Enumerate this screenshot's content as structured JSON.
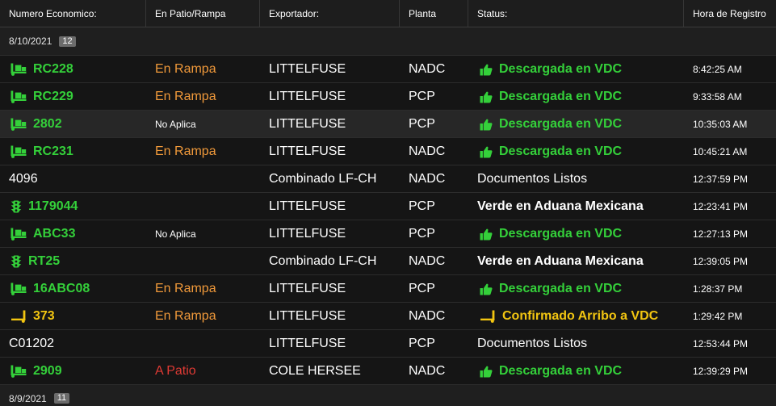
{
  "columns": {
    "numero": "Numero Economico:",
    "patio": "En Patio/Rampa",
    "exportador": "Exportador:",
    "planta": "Planta",
    "status": "Status:",
    "hora": "Hora de Registro"
  },
  "colors": {
    "background": "#151515",
    "green": "#34d03a",
    "orange": "#f0993a",
    "yellow": "#f2c511",
    "red": "#e03a34",
    "white": "#ffffff",
    "badge": "#6b6b6b"
  },
  "groups": [
    {
      "date": "8/10/2021",
      "count": "12",
      "rows": [
        {
          "numero": "RC228",
          "numero_icon": "dolly-icon",
          "numero_color": "#34d03a",
          "numero_bold": true,
          "patio": "En Rampa",
          "patio_color": "#f0993a",
          "exportador": "LITTELFUSE",
          "planta": "NADC",
          "status": "Descargada en VDC",
          "status_icon": "thumbs-up-icon",
          "status_color": "#34d03a",
          "status_bold": true,
          "hora": "8:42:25 AM"
        },
        {
          "numero": "RC229",
          "numero_icon": "dolly-icon",
          "numero_color": "#34d03a",
          "numero_bold": true,
          "patio": "En Rampa",
          "patio_color": "#f0993a",
          "exportador": "LITTELFUSE",
          "planta": "PCP",
          "status": "Descargada en VDC",
          "status_icon": "thumbs-up-icon",
          "status_color": "#34d03a",
          "status_bold": true,
          "hora": "9:33:58 AM"
        },
        {
          "numero": "2802",
          "numero_icon": "dolly-icon",
          "numero_color": "#34d03a",
          "numero_bold": true,
          "patio": "No Aplica",
          "patio_color": "#ffffff",
          "patio_small": true,
          "exportador": "LITTELFUSE",
          "planta": "PCP",
          "status": "Descargada en VDC",
          "status_icon": "thumbs-up-icon",
          "status_color": "#34d03a",
          "status_bold": true,
          "hora": "10:35:03 AM",
          "highlighted": true
        },
        {
          "numero": "RC231",
          "numero_icon": "dolly-icon",
          "numero_color": "#34d03a",
          "numero_bold": true,
          "patio": "En Rampa",
          "patio_color": "#f0993a",
          "exportador": "LITTELFUSE",
          "planta": "NADC",
          "status": "Descargada en VDC",
          "status_icon": "thumbs-up-icon",
          "status_color": "#34d03a",
          "status_bold": true,
          "hora": "10:45:21 AM"
        },
        {
          "numero": "4096",
          "numero_color": "#ffffff",
          "numero_bold": false,
          "exportador": "Combinado LF-CH",
          "planta": "NADC",
          "status": "Documentos Listos",
          "status_color": "#ffffff",
          "status_bold": false,
          "hora": "12:37:59 PM"
        },
        {
          "numero": "1179044",
          "numero_icon": "traffic-light-icon",
          "numero_color": "#34d03a",
          "numero_bold": true,
          "exportador": "LITTELFUSE",
          "planta": "PCP",
          "status": "Verde en Aduana Mexicana",
          "status_color": "#ffffff",
          "status_bold": true,
          "hora": "12:23:41 PM"
        },
        {
          "numero": "ABC33",
          "numero_icon": "dolly-icon",
          "numero_color": "#34d03a",
          "numero_bold": true,
          "patio": "No Aplica",
          "patio_color": "#ffffff",
          "patio_small": true,
          "exportador": "LITTELFUSE",
          "planta": "PCP",
          "status": "Descargada en VDC",
          "status_icon": "thumbs-up-icon",
          "status_color": "#34d03a",
          "status_bold": true,
          "hora": "12:27:13 PM"
        },
        {
          "numero": "RT25",
          "numero_icon": "traffic-light-icon",
          "numero_color": "#34d03a",
          "numero_bold": true,
          "exportador": "Combinado LF-CH",
          "planta": "NADC",
          "status": "Verde en Aduana Mexicana",
          "status_color": "#ffffff",
          "status_bold": true,
          "hora": "12:39:05 PM"
        },
        {
          "numero": "16ABC08",
          "numero_icon": "dolly-icon",
          "numero_color": "#34d03a",
          "numero_bold": true,
          "patio": "En Rampa",
          "patio_color": "#f0993a",
          "exportador": "LITTELFUSE",
          "planta": "PCP",
          "status": "Descargada en VDC",
          "status_icon": "thumbs-up-icon",
          "status_color": "#34d03a",
          "status_bold": true,
          "hora": "1:28:37 PM"
        },
        {
          "numero": "373",
          "numero_icon": "hand-truck-icon",
          "numero_color": "#f2c511",
          "numero_bold": true,
          "patio": "En Rampa",
          "patio_color": "#f0993a",
          "exportador": "LITTELFUSE",
          "planta": "NADC",
          "status": "Confirmado Arribo a VDC",
          "status_icon": "hand-truck-icon",
          "status_color": "#f2c511",
          "status_bold": true,
          "hora": "1:29:42 PM"
        },
        {
          "numero": "C01202",
          "numero_color": "#ffffff",
          "numero_bold": false,
          "exportador": "LITTELFUSE",
          "planta": "PCP",
          "status": "Documentos Listos",
          "status_color": "#ffffff",
          "status_bold": false,
          "hora": "12:53:44 PM"
        },
        {
          "numero": "2909",
          "numero_icon": "dolly-icon",
          "numero_color": "#34d03a",
          "numero_bold": true,
          "patio": "A Patio",
          "patio_color": "#e03a34",
          "exportador": "COLE HERSEE",
          "planta": "NADC",
          "status": "Descargada en VDC",
          "status_icon": "thumbs-up-icon",
          "status_color": "#34d03a",
          "status_bold": true,
          "hora": "12:39:29 PM"
        }
      ]
    },
    {
      "date": "8/9/2021",
      "count": "11",
      "rows": []
    }
  ]
}
